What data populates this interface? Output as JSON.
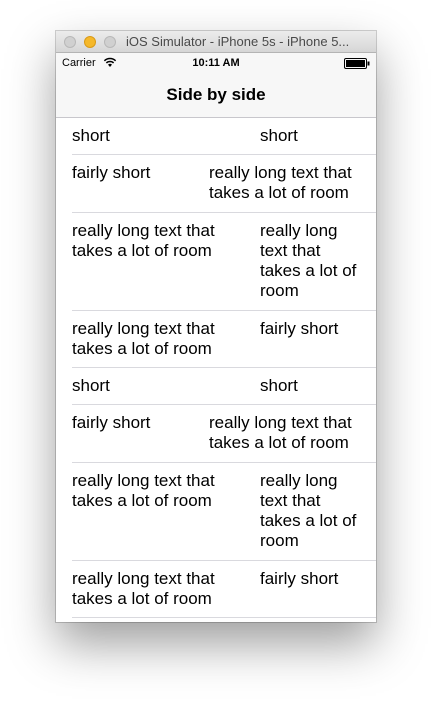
{
  "window": {
    "title": "iOS Simulator - iPhone 5s - iPhone 5..."
  },
  "status_bar": {
    "carrier": "Carrier",
    "time": "10:11 AM",
    "wifi_icon": "wifi-icon",
    "battery_icon": "battery-icon"
  },
  "nav": {
    "title": "Side by side"
  },
  "rows": [
    {
      "left": "short",
      "right": "short"
    },
    {
      "left": "fairly short",
      "right": "really long text that takes a lot of room"
    },
    {
      "left": "really long text that takes a lot of room",
      "right": "really long text that takes a lot of room"
    },
    {
      "left": "really long text that takes a lot of room",
      "right": "fairly short"
    },
    {
      "left": "short",
      "right": "short"
    },
    {
      "left": "fairly short",
      "right": "really long text that takes a lot of room"
    },
    {
      "left": "really long text that takes a lot of room",
      "right": "really long text that takes a lot of room"
    },
    {
      "left": "really long text that takes a lot of room",
      "right": "fairly short"
    }
  ]
}
